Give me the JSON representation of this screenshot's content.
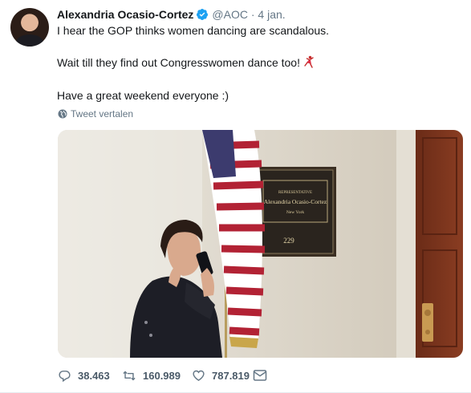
{
  "tweet": {
    "author_name": "Alexandria Ocasio-Cortez",
    "handle": "@AOC",
    "separator": "·",
    "time": "4 jan.",
    "lines": [
      "I hear the GOP thinks women dancing are scandalous.",
      "Wait till they find out Congresswomen dance too!",
      "Have a great weekend everyone :)"
    ],
    "translate_label": "Tweet vertalen"
  },
  "media": {
    "plaque_title": "REPRESENTATIVE",
    "plaque_name": "Alexandria Ocasio-Cortez",
    "plaque_state": "New York",
    "room_number": "229"
  },
  "actions": {
    "replies": "38.463",
    "retweets": "160.989",
    "likes": "787.819"
  },
  "colors": {
    "verified": "#1da1f2",
    "secondary_text": "#657786",
    "primary_text": "#14171a"
  }
}
